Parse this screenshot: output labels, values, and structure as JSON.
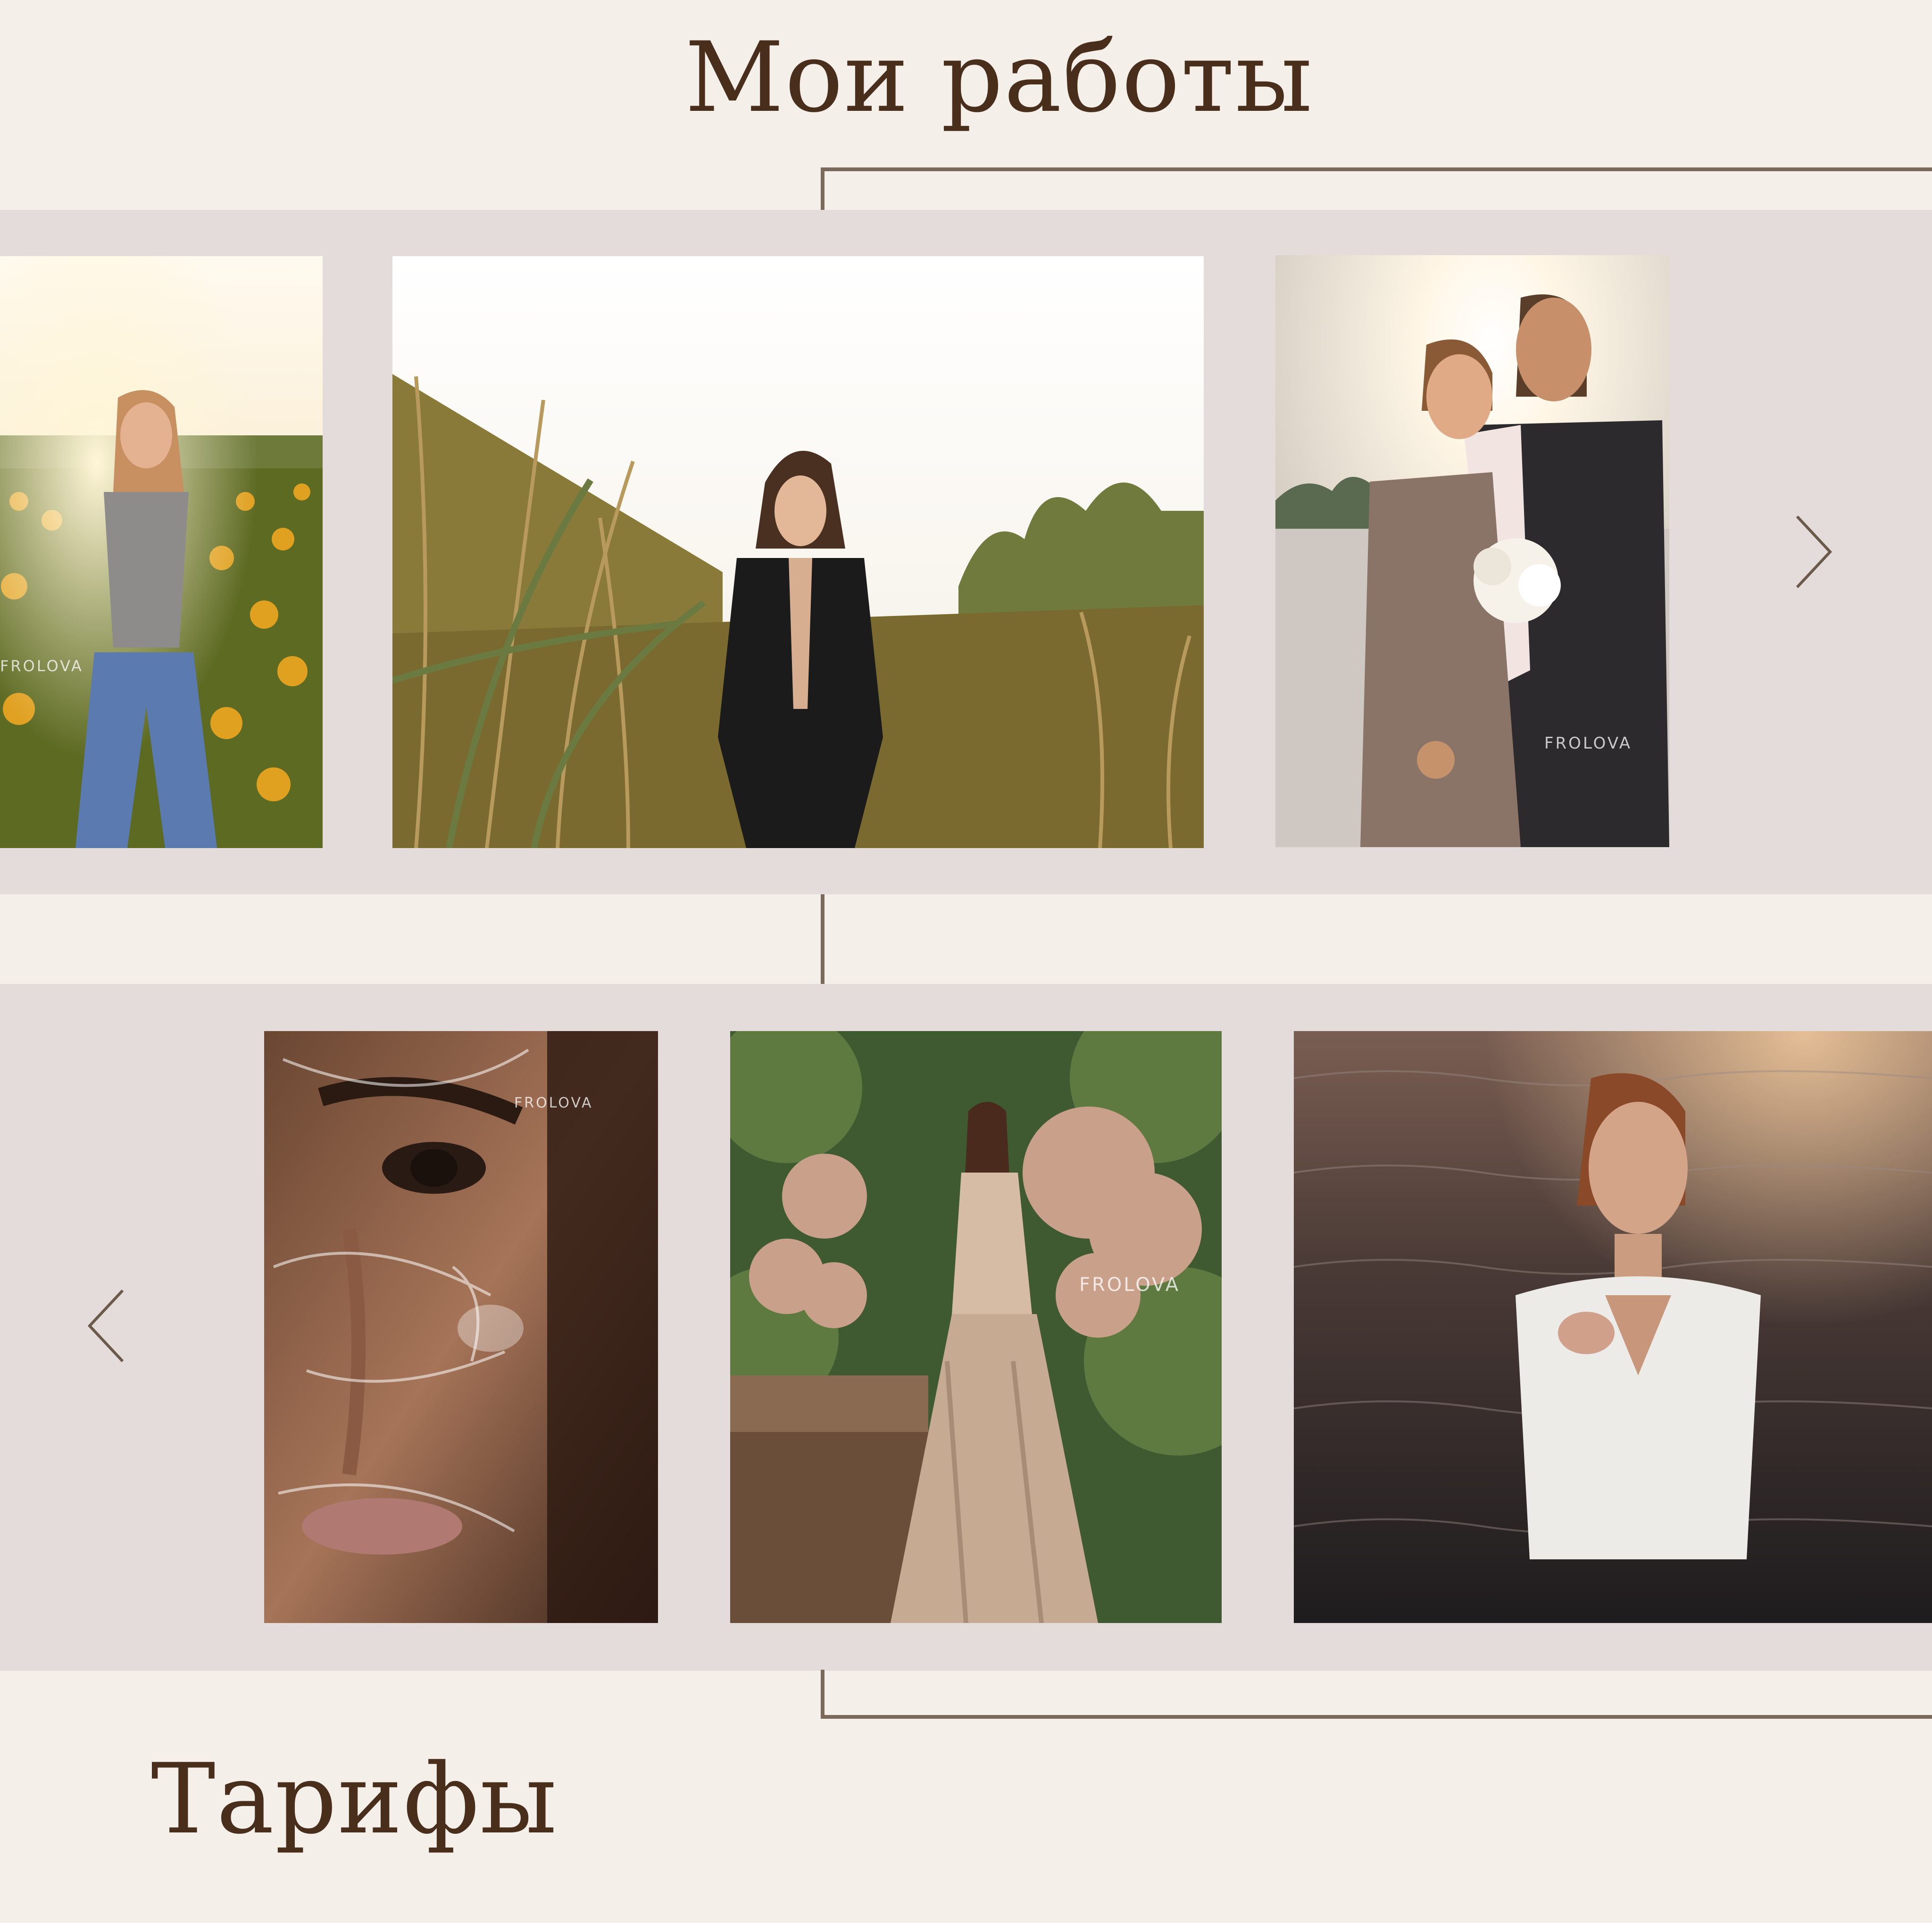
{
  "header": {
    "title": "Мои работы"
  },
  "gallery": {
    "row1": [
      {
        "name": "sunflower-field-portrait"
      },
      {
        "name": "reeds-leather-jacket-portrait"
      },
      {
        "name": "couple-sunset-bouquet"
      }
    ],
    "row2": [
      {
        "name": "plastic-wrap-face-portrait"
      },
      {
        "name": "bride-garden-dress"
      },
      {
        "name": "woman-in-water-portrait"
      }
    ],
    "watermark": "FROLOVA",
    "next_icon": "chevron-right-icon",
    "prev_icon": "chevron-left-icon"
  },
  "pricing": {
    "title": "Тарифы"
  },
  "colors": {
    "background": "#f4f0e9",
    "band": "#e3dcda",
    "heading": "#4a2e1c",
    "line": "#7a6a5c"
  }
}
